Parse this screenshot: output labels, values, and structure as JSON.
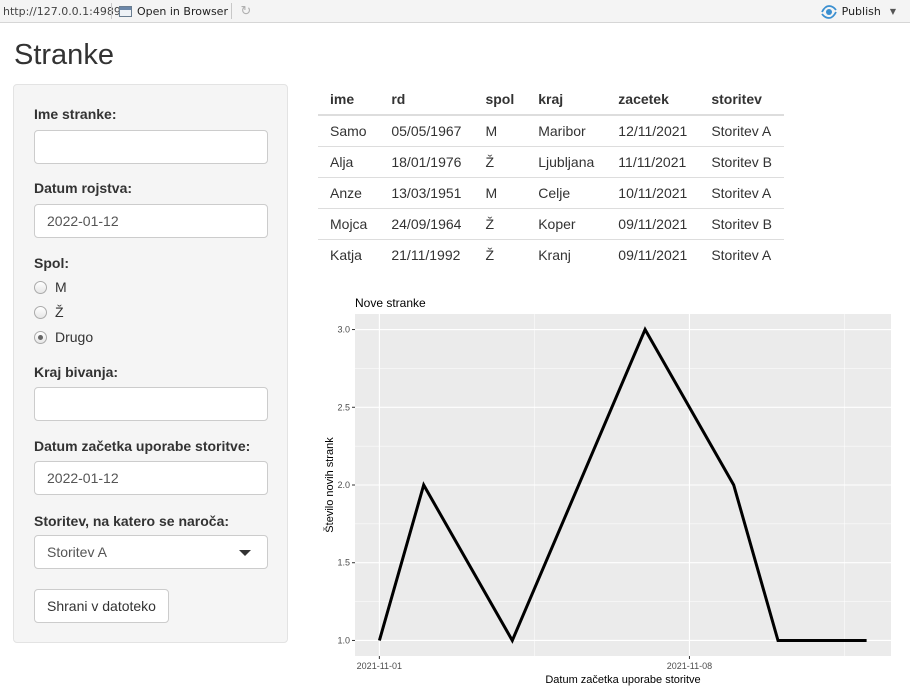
{
  "viewer": {
    "url": "http://127.0.0.1:4989",
    "open_in_browser": "Open in Browser",
    "publish": "Publish",
    "icons": [
      "open-browser-icon",
      "refresh-icon",
      "publish-icon",
      "caret-down-icon"
    ]
  },
  "page": {
    "title": "Stranke"
  },
  "form": {
    "name_label": "Ime stranke:",
    "name_value": "",
    "dob_label": "Datum rojstva:",
    "dob_value": "2022-01-12",
    "sex_label": "Spol:",
    "sex_options": [
      "M",
      "Ž",
      "Drugo"
    ],
    "sex_selected": "Drugo",
    "city_label": "Kraj bivanja:",
    "city_value": "",
    "start_label": "Datum začetka uporabe storitve:",
    "start_value": "2022-01-12",
    "service_label": "Storitev, na katero se naroča:",
    "service_value": "Storitev A",
    "save_button": "Shrani v datoteko"
  },
  "table": {
    "columns": [
      "ime",
      "rd",
      "spol",
      "kraj",
      "zacetek",
      "storitev"
    ],
    "rows": [
      [
        "Samo",
        "05/05/1967",
        "M",
        "Maribor",
        "12/11/2021",
        "Storitev A"
      ],
      [
        "Alja",
        "18/01/1976",
        "Ž",
        "Ljubljana",
        "11/11/2021",
        "Storitev B"
      ],
      [
        "Anze",
        "13/03/1951",
        "M",
        "Celje",
        "10/11/2021",
        "Storitev A"
      ],
      [
        "Mojca",
        "24/09/1964",
        "Ž",
        "Koper",
        "09/11/2021",
        "Storitev B"
      ],
      [
        "Katja",
        "21/11/1992",
        "Ž",
        "Kranj",
        "09/11/2021",
        "Storitev A"
      ]
    ]
  },
  "chart_data": {
    "type": "line",
    "title": "Nove stranke",
    "xlabel": "Datum začetka uporabe storitve",
    "ylabel": "Število novih strank",
    "x": [
      "2021-11-01",
      "2021-11-02",
      "2021-11-04",
      "2021-11-07",
      "2021-11-09",
      "2021-11-10",
      "2021-11-12"
    ],
    "values": [
      1,
      2,
      1,
      3,
      2,
      1,
      1
    ],
    "xlim": [
      "2020-10-31",
      "2021-11-12"
    ],
    "x_ticks": [
      "2021-11-01",
      "2021-11-08"
    ],
    "ylim": [
      1,
      3
    ],
    "y_ticks": [
      "1.0",
      "1.5",
      "2.0",
      "2.5",
      "3.0"
    ],
    "grid": true,
    "panel_color": "#ebebeb",
    "line_color": "#000000"
  }
}
